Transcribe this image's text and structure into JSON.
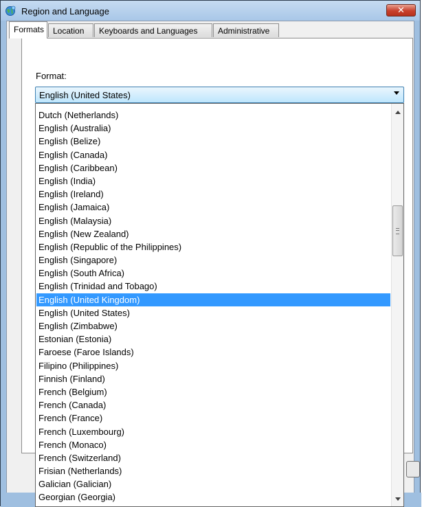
{
  "window": {
    "title": "Region and Language",
    "close_label": "✕",
    "app_icon": "globe-icon"
  },
  "tabs": [
    {
      "label": "Formats",
      "active": true
    },
    {
      "label": "Location",
      "active": false
    },
    {
      "label": "Keyboards and Languages",
      "active": false
    },
    {
      "label": "Administrative",
      "active": false
    }
  ],
  "format": {
    "label": "Format:",
    "selected_value": "English (United States)"
  },
  "dropdown": {
    "items": [
      "Dutch (Netherlands)",
      "English (Australia)",
      "English (Belize)",
      "English (Canada)",
      "English (Caribbean)",
      "English (India)",
      "English (Ireland)",
      "English (Jamaica)",
      "English (Malaysia)",
      "English (New Zealand)",
      "English (Republic of the Philippines)",
      "English (Singapore)",
      "English (South Africa)",
      "English (Trinidad and Tobago)",
      "English (United Kingdom)",
      "English (United States)",
      "English (Zimbabwe)",
      "Estonian (Estonia)",
      "Faroese (Faroe Islands)",
      "Filipino (Philippines)",
      "Finnish (Finland)",
      "French (Belgium)",
      "French (Canada)",
      "French (France)",
      "French (Luxembourg)",
      "French (Monaco)",
      "French (Switzerland)",
      "Frisian (Netherlands)",
      "Galician (Galician)",
      "Georgian (Georgia)"
    ],
    "highlighted": "English (United Kingdom)"
  },
  "colors": {
    "highlight": "#3399ff",
    "combo_border": "#3c7fb1",
    "close_button": "#c7402c"
  }
}
